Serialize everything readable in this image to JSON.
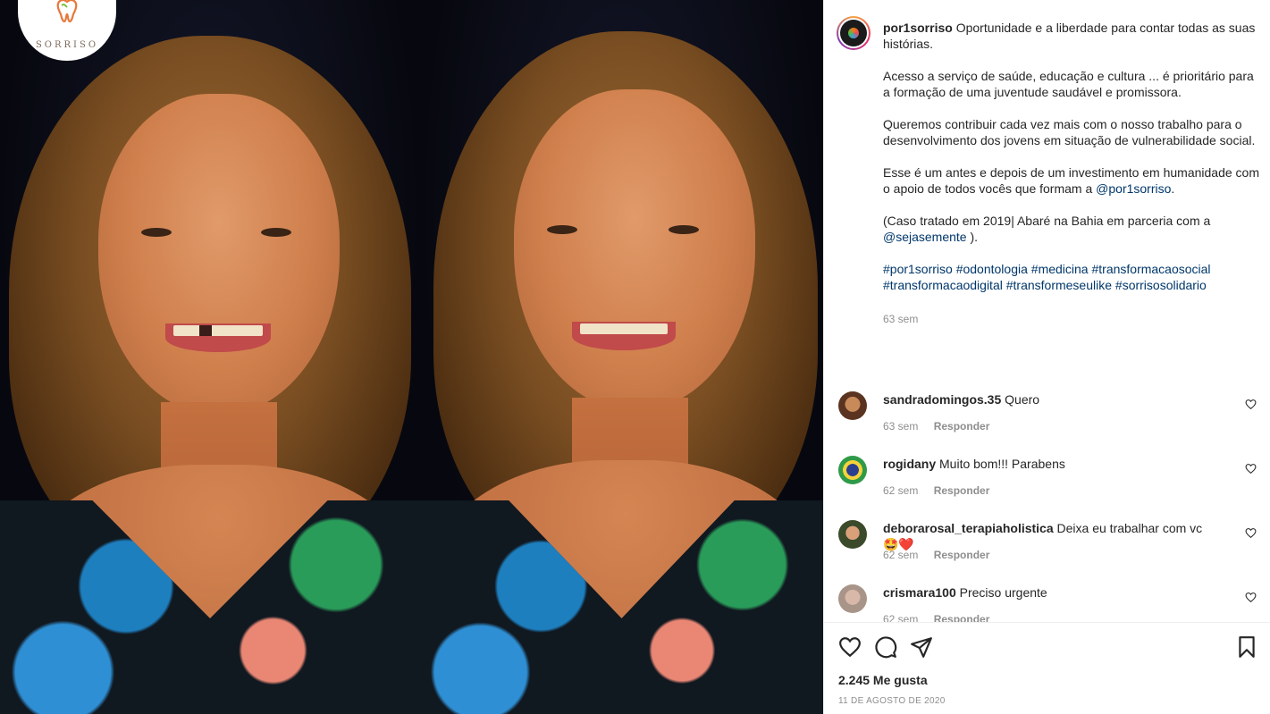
{
  "post": {
    "username": "por1sorriso",
    "caption_paragraphs": [
      "Oportunidade e a liberdade para contar todas as suas histórias.",
      "Acesso a serviço de saúde, educação e cultura ... é prioritário para a formação de uma juventude saudável e promissora.",
      "Queremos contribuir cada vez mais com o nosso trabalho para o desenvolvimento dos jovens em situação de vulnerabilidade social."
    ],
    "caption_p4_text": "Esse é um antes e depois de um investimento em humanidade com o apoio de todos vocês que formam a",
    "caption_p4_mention": "@por1sorriso",
    "caption_p4_end": ".",
    "caption_p5_text": "(Caso tratado em 2019| Abaré na Bahia em parceria com a",
    "caption_p5_mention": "@sejasemente",
    "caption_p5_end": ").",
    "hashtags": "#por1sorriso #odontologia #medicina #transformacaosocial #transformacaodigital #transformeseulike #sorrisosolidario",
    "caption_time": "63 sem"
  },
  "logo": {
    "text": "SORRISO"
  },
  "comments": [
    {
      "user": "sandradomingos.35",
      "text": "Quero",
      "time": "63 sem",
      "reply": "Responder"
    },
    {
      "user": "rogidany",
      "text": "Muito bom!!! Parabens",
      "time": "62 sem",
      "reply": "Responder"
    },
    {
      "user": "deborarosal_terapiaholistica",
      "text": "Deixa eu trabalhar com vc",
      "emoji": "🤩❤️",
      "time": "62 sem",
      "reply": "Responder"
    },
    {
      "user": "crismara100",
      "text": "Preciso urgente",
      "time": "62 sem",
      "reply": "Responder"
    }
  ],
  "actions": {
    "like_icon": "heart-icon",
    "comment_icon": "comment-icon",
    "share_icon": "share-icon",
    "save_icon": "bookmark-icon"
  },
  "likes_text": "2.245 Me gusta",
  "date_text": "11 DE AGOSTO DE 2020",
  "colors": {
    "link": "#00376b",
    "meta": "#8e8e8e",
    "text": "#262626"
  }
}
